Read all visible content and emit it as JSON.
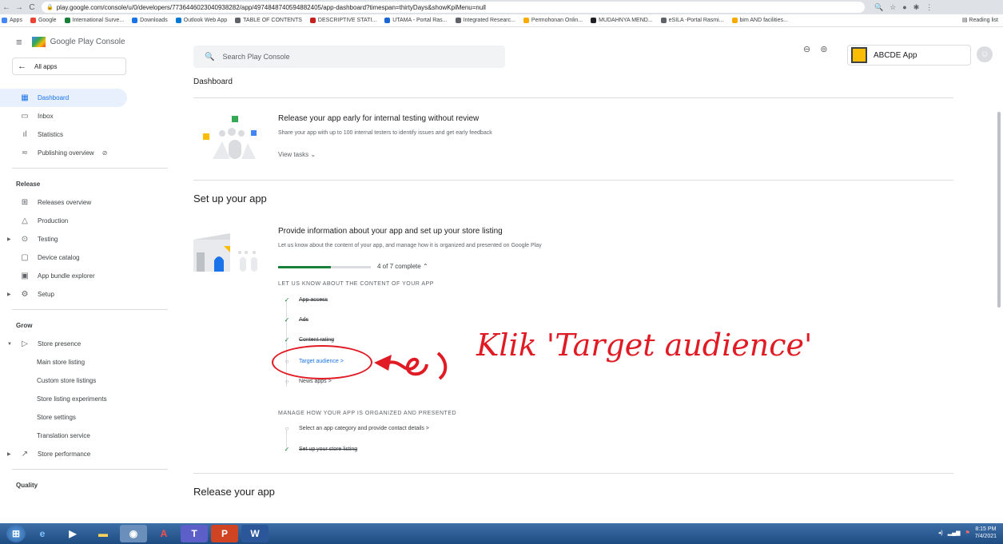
{
  "browser": {
    "url": "play.google.com/console/u/0/developers/7736446023040938282/app/4974848740594882405/app-dashboard?timespan=thirtyDays&showKpiMenu=null",
    "bookmarks": [
      "Apps",
      "Google",
      "International Surve...",
      "Downloads",
      "Outlook Web App",
      "TABLE OF CONTENTS",
      "DESCRIPTIVE STATI...",
      "UTAMA - Portal Ras...",
      "Integrated Researc...",
      "Permohonan Onlin...",
      "MUDAHNYA MEND...",
      "eSILA -Portal Rasmi...",
      "bim AND facilities..."
    ],
    "reading_list": "Reading list"
  },
  "sidebar": {
    "brand": "Google Play Console",
    "all_apps": "All apps",
    "items": [
      "Dashboard",
      "Inbox",
      "Statistics",
      "Publishing overview"
    ],
    "release_header": "Release",
    "release_items": [
      "Releases overview",
      "Production",
      "Testing",
      "Device catalog",
      "App bundle explorer",
      "Setup"
    ],
    "grow_header": "Grow",
    "store_presence": "Store presence",
    "store_sub": [
      "Main store listing",
      "Custom store listings",
      "Store listing experiments",
      "Store settings",
      "Translation service"
    ],
    "store_performance": "Store performance",
    "quality_header": "Quality"
  },
  "topbar": {
    "search_placeholder": "Search Play Console",
    "app_name": "ABCDE App"
  },
  "main": {
    "page_title": "Dashboard",
    "release_card": {
      "title": "Release your app early for internal testing without review",
      "subtitle": "Share your app with up to 100 internal testers to identify issues and get early feedback",
      "view_tasks": "View tasks"
    },
    "setup_title": "Set up your app",
    "setup_card": {
      "title": "Provide information about your app and set up your store listing",
      "subtitle": "Let us know about the content of your app, and manage how it is organized and presented on Google Play",
      "progress_text": "4 of 7 complete",
      "progress": 0.57,
      "group1": "LET US KNOW ABOUT THE CONTENT OF YOUR APP",
      "tasks1": [
        "App access",
        "Ads",
        "Content rating",
        "Target audience >",
        "News apps >"
      ],
      "group2": "MANAGE HOW YOUR APP IS ORGANIZED AND PRESENTED",
      "tasks2": [
        "Select an app category and provide contact details >",
        "Set up your store listing"
      ]
    },
    "release_title": "Release your app"
  },
  "annotation": "Klik 'Target audience'",
  "taskbar": {
    "time": "8:15 PM",
    "date": "7/4/2021"
  },
  "colors": {
    "accent": "#1a73e8",
    "success": "#188038",
    "annotation": "#e01b24"
  }
}
